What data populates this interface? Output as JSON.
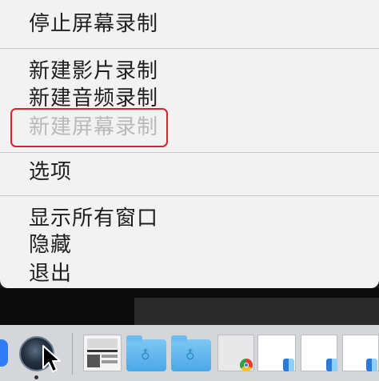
{
  "menu": {
    "stop_screen_recording": "停止屏幕录制",
    "new_movie_recording": "新建影片录制",
    "new_audio_recording": "新建音频录制",
    "new_screen_recording": "新建屏幕录制",
    "options": "选项",
    "show_all_windows": "显示所有窗口",
    "hide": "隐藏",
    "quit": "退出"
  },
  "colors": {
    "highlight_border": "#d6232e",
    "menu_background": "#f2f2f2",
    "disabled_text": "#b9b9b9"
  },
  "dock": {
    "icons": [
      "app-icon",
      "quicktime-player-icon",
      "cursor-icon",
      "recent-document-thumbnail",
      "folder-icon",
      "folder-icon",
      "window-thumbnail",
      "chrome-icon",
      "finder-icon"
    ]
  }
}
